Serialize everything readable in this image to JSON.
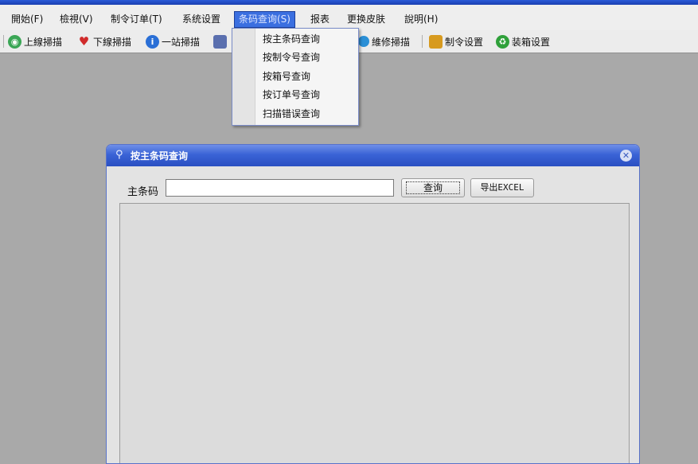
{
  "menubar": {
    "items": [
      {
        "label": "開始(F)"
      },
      {
        "label": "檢視(V)"
      },
      {
        "label": "制令订单(T)"
      },
      {
        "label": "系统设置"
      },
      {
        "label": "条码查询(S)"
      },
      {
        "label": "报表"
      },
      {
        "label": "更换皮肤"
      },
      {
        "label": "說明(H)"
      }
    ]
  },
  "toolbar": {
    "items": [
      {
        "label": "上線掃描",
        "icon": "globe-icon",
        "color": "#3aa655"
      },
      {
        "label": "下線掃描",
        "icon": "heart-icon",
        "color": "#d02b2b"
      },
      {
        "label": "一站掃描",
        "icon": "info-icon",
        "color": "#2a6fd6"
      },
      {
        "label": "維修掃描",
        "icon": "wrench-icon",
        "color": "#2a8fd6"
      },
      {
        "label": "制令设置",
        "icon": "tools-icon",
        "color": "#d79a1f"
      },
      {
        "label": "装箱设置",
        "icon": "recycle-icon",
        "color": "#2fa03a"
      }
    ]
  },
  "dropdown": {
    "items": [
      {
        "label": "按主条码查询"
      },
      {
        "label": "按制令号查询"
      },
      {
        "label": "按箱号查询"
      },
      {
        "label": "按订单号查询"
      },
      {
        "label": "扫描错误查询"
      }
    ]
  },
  "dialog": {
    "title": "按主条码查询",
    "barcode_label": "主条码",
    "barcode_value": "",
    "query_label": "查询",
    "export_label": "导出EXCEL"
  }
}
